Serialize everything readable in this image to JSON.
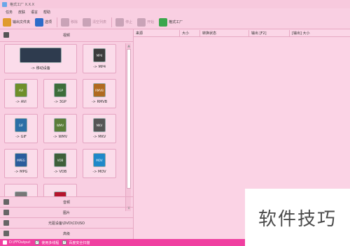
{
  "window": {
    "title": "格式工厂 X.X.X"
  },
  "menu": [
    "任务",
    "皮肤",
    "语言",
    "帮助"
  ],
  "toolbar": [
    {
      "label": "输出文件夹",
      "icon": "folder-icon",
      "color": "#e09b2e",
      "disabled": false
    },
    {
      "label": "选项",
      "icon": "options-icon",
      "color": "#2d6cc9",
      "disabled": false
    },
    {
      "label": "移除",
      "icon": "remove-icon",
      "color": "#c9a3b7",
      "disabled": true
    },
    {
      "label": "清空列表",
      "icon": "clear-list-icon",
      "color": "#c9a3b7",
      "disabled": true
    },
    {
      "label": "停止",
      "icon": "stop-icon",
      "color": "#c9a3b7",
      "disabled": true
    },
    {
      "label": "开始",
      "icon": "start-icon",
      "color": "#c9a3b7",
      "disabled": true
    },
    {
      "label": "格式工厂",
      "icon": "format-factory-logo-icon",
      "color": "#3aa64c",
      "disabled": false
    }
  ],
  "sidebar": {
    "header": "视频",
    "tiles": [
      {
        "label": "-> 移动设备",
        "badge": "",
        "color": "#2e3b4e",
        "icon": "mobile-devices-icon"
      },
      {
        "label": "-> MP4",
        "badge": "MP4",
        "color": "#3c3c3c",
        "icon": "mp4-icon"
      },
      {
        "label": "-> AVI",
        "badge": "AVI",
        "color": "#6f8f2a",
        "icon": "avi-icon"
      },
      {
        "label": "-> 3GP",
        "badge": "3GP",
        "color": "#3d6d3a",
        "icon": "3gp-icon"
      },
      {
        "label": "-> RMVB",
        "badge": "RMVB",
        "color": "#b06a20",
        "icon": "rmvb-icon"
      },
      {
        "label": "-> GIF",
        "badge": "GIF",
        "color": "#2b6fa6",
        "icon": "gif-icon"
      },
      {
        "label": "-> WMV",
        "badge": "WMV",
        "color": "#5c7d3a",
        "icon": "wmv-icon"
      },
      {
        "label": "-> MKV",
        "badge": "MKV",
        "color": "#555555",
        "icon": "mkv-icon"
      },
      {
        "label": "-> MPG",
        "badge": "MPEG",
        "color": "#2a5c9c",
        "icon": "mpg-icon"
      },
      {
        "label": "-> VOB",
        "badge": "VOB",
        "color": "#3f5f3a",
        "icon": "vob-icon"
      },
      {
        "label": "-> MOV",
        "badge": "MOV",
        "color": "#1e88c9",
        "icon": "mov-icon"
      },
      {
        "label": "",
        "badge": "",
        "color": "#777777",
        "icon": "video-partial-icon"
      },
      {
        "label": "",
        "badge": "",
        "color": "#b5142c",
        "icon": "flash-partial-icon"
      }
    ],
    "categories": [
      {
        "label": "音频",
        "icon": "audio-icon"
      },
      {
        "label": "图片",
        "icon": "picture-icon"
      },
      {
        "label": "光驱设备\\DVD\\CD\\ISO",
        "icon": "optical-drive-icon"
      },
      {
        "label": "高级",
        "icon": "advanced-icon"
      }
    ]
  },
  "task_table": {
    "columns": [
      "来源",
      "大小",
      "转换状态",
      "输出 [F2]",
      "[输出] 大小"
    ]
  },
  "status": {
    "output_path": "D:\\FFOutput",
    "multithread_label": "使用多线程",
    "multithread_checked": true,
    "security_label": "百度安全扫描",
    "security_checked": true
  },
  "watermark": "软件技巧"
}
